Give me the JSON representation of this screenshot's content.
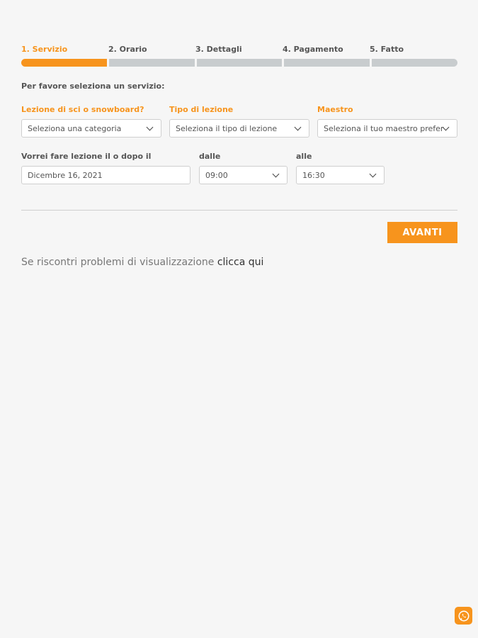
{
  "steps": [
    "1. Servizio",
    "2. Orario",
    "3. Dettagli",
    "4. Pagamento",
    "5. Fatto"
  ],
  "active_step": 1,
  "instruction": "Per favore seleziona un servizio:",
  "category": {
    "label": "Lezione di sci o snowboard?",
    "placeholder": "Seleziona una categoria"
  },
  "lesson_type": {
    "label": "Tipo di lezione",
    "placeholder": "Seleziona il tipo di lezione"
  },
  "instructor": {
    "label": "Maestro",
    "placeholder": "Seleziona il tuo maestro prefer"
  },
  "date": {
    "label": "Vorrei fare lezione il o dopo il",
    "value": "Dicembre 16, 2021"
  },
  "from": {
    "label": "dalle",
    "value": "09:00"
  },
  "to": {
    "label": "alle",
    "value": "16:30"
  },
  "next_button": "AVANTI",
  "problem": {
    "text": "Se riscontri problemi di visualizzazione",
    "link": "clicca qui"
  },
  "colors": {
    "accent": "#f7941d",
    "inactive": "#c8ccce"
  },
  "icons": [
    "chevron-down-icon",
    "whatsapp-icon"
  ]
}
